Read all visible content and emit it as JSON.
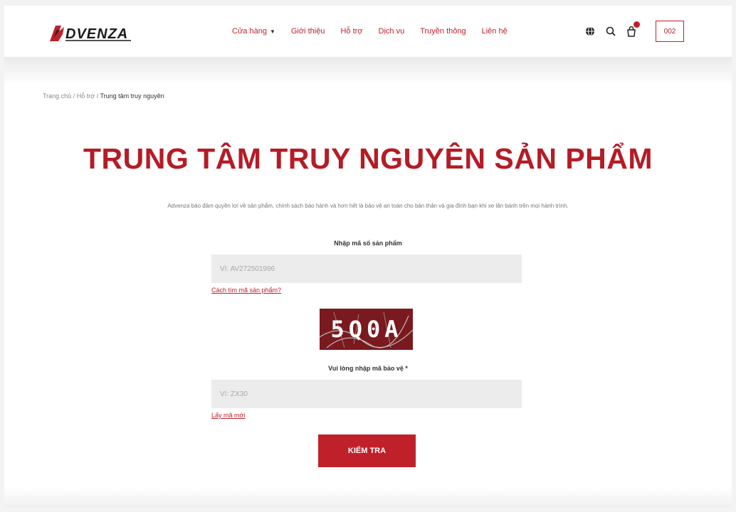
{
  "brand": {
    "logo_text": "DVENZA",
    "accent": "#c0202a"
  },
  "nav": {
    "items": [
      {
        "label": "Cửa hàng",
        "has_dropdown": true
      },
      {
        "label": "Giới thiệu"
      },
      {
        "label": "Hỗ trợ"
      },
      {
        "label": "Dịch vụ"
      },
      {
        "label": "Truyền thông"
      },
      {
        "label": "Liên hệ"
      }
    ],
    "icons": [
      "globe-icon",
      "search-icon",
      "bag-icon"
    ],
    "lang_button": "002"
  },
  "breadcrumb": {
    "home": "Trang chủ",
    "sep": " / ",
    "parent": "Hỗ trợ",
    "current": "Trung tâm truy nguyên"
  },
  "main": {
    "title": "TRUNG TÂM TRUY NGUYÊN SẢN PHẨM",
    "subtitle": "Advenza bảo đảm quyền lợi về sản phẩm, chính sách bảo hành và hơn hết là bảo vệ an toàn cho bản thân và gia đình bạn khi xe lăn bánh trên mọi hành trình.",
    "product_code": {
      "label": "Nhập mã số sản phẩm",
      "placeholder": "Ví: AV272501996",
      "help_link": "Cách tìm mã sản phẩm?"
    },
    "captcha": {
      "text": "5Q0A"
    },
    "security_code": {
      "label": "Vui lòng nhập mã bảo vệ *",
      "placeholder": "Ví: ZX30",
      "refresh_link": "Lấy mã mới"
    },
    "submit_label": "KIỂM TRA"
  }
}
